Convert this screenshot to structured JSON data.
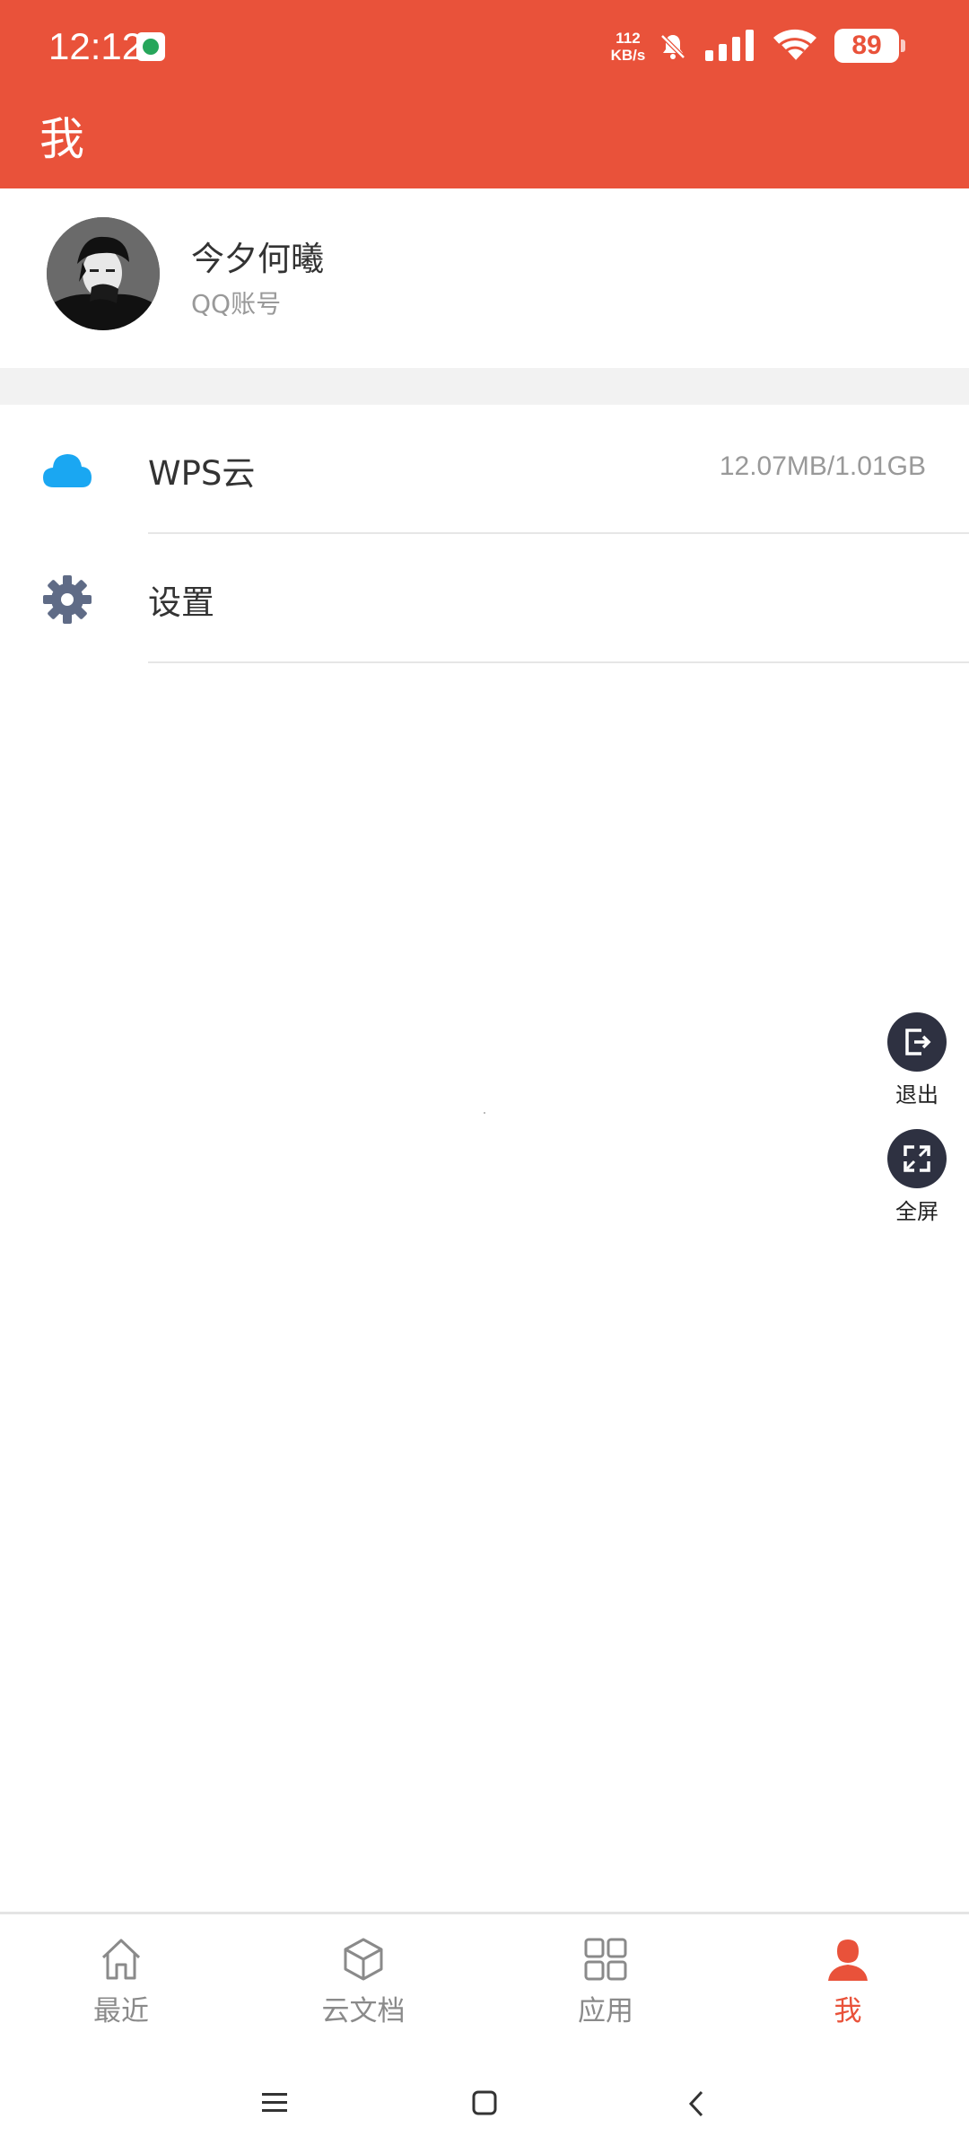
{
  "status_bar": {
    "time": "12:12",
    "net_speed_value": "112",
    "net_speed_unit": "KB/s",
    "battery": "89",
    "icons": [
      "app-notification-icon",
      "bell-muted-icon",
      "signal-icon",
      "wifi-icon",
      "battery-icon"
    ]
  },
  "header": {
    "title": "我"
  },
  "profile": {
    "name": "今夕何曦",
    "account_type": "QQ账号"
  },
  "menu": [
    {
      "icon": "cloud-icon",
      "label": "WPS云",
      "value": "12.07MB/1.01GB"
    },
    {
      "icon": "gear-icon",
      "label": "设置",
      "value": ""
    }
  ],
  "floating": {
    "exit_label": "退出",
    "fullscreen_label": "全屏"
  },
  "bottom_nav": {
    "items": [
      {
        "icon": "home-icon",
        "label": "最近",
        "active": false
      },
      {
        "icon": "cube-icon",
        "label": "云文档",
        "active": false
      },
      {
        "icon": "grid-icon",
        "label": "应用",
        "active": false
      },
      {
        "icon": "person-icon",
        "label": "我",
        "active": true
      }
    ]
  },
  "colors": {
    "brand": "#e9523a",
    "cloud": "#1aa7f2",
    "gear": "#5f6b86",
    "float_button": "#2e3141"
  }
}
